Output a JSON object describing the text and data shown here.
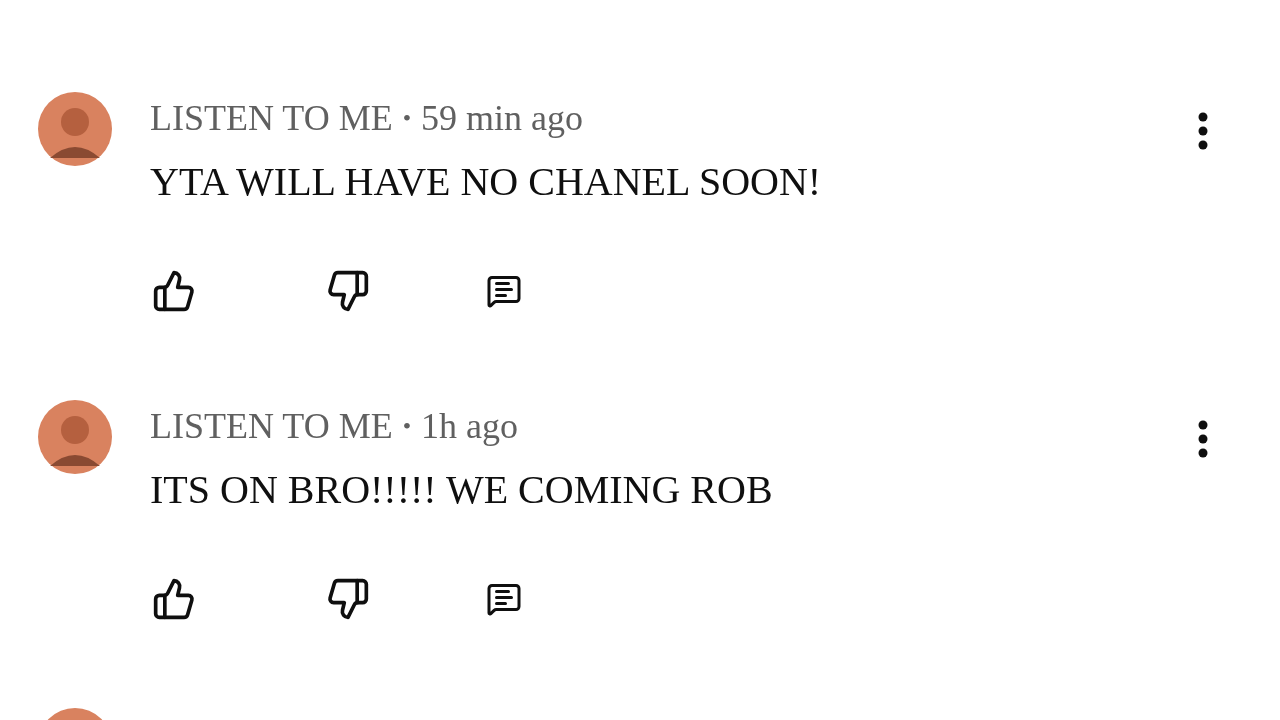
{
  "comments": [
    {
      "author": "LISTEN TO ME",
      "separator": "•",
      "time": "59 min ago",
      "text": "YTA WILL HAVE NO CHANEL SOON!"
    },
    {
      "author": "LISTEN TO ME",
      "separator": "•",
      "time": "1h ago",
      "text": "ITS ON BRO!!!!! WE COMING ROB"
    }
  ]
}
